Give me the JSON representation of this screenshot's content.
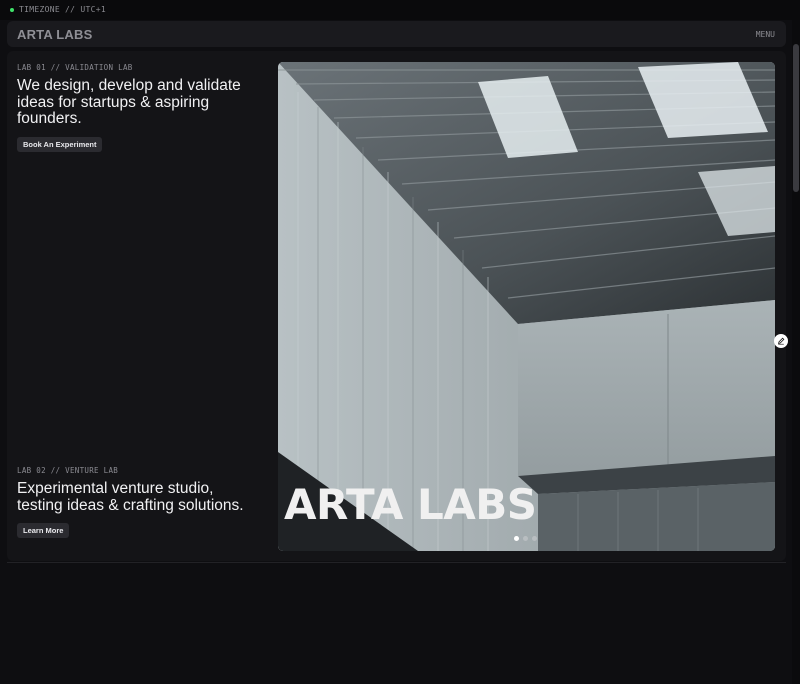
{
  "topbar": {
    "timezone_text": "TIMEZONE // UTC+1"
  },
  "header": {
    "logo": "ARTA LABS",
    "menu_label": "MENU"
  },
  "lab1": {
    "label": "LAB 01 // VALIDATION LAB",
    "title": "We design, develop and validate ideas for startups & aspiring founders.",
    "button_label": "Book An Experiment"
  },
  "lab2": {
    "label": "LAB 02 // VENTURE LAB",
    "title": "Experimental venture studio, testing ideas & crafting solutions.",
    "button_label": "Learn More"
  },
  "hero": {
    "title": "ARTA LABS",
    "carousel": {
      "slide_count": 3,
      "active_index": 0
    }
  },
  "icons": {
    "edit": "pencil-icon",
    "status": "status-dot-icon"
  },
  "colors": {
    "status_dot": "#3fe26a",
    "background": "#0e0e11",
    "panel": "#141417"
  }
}
